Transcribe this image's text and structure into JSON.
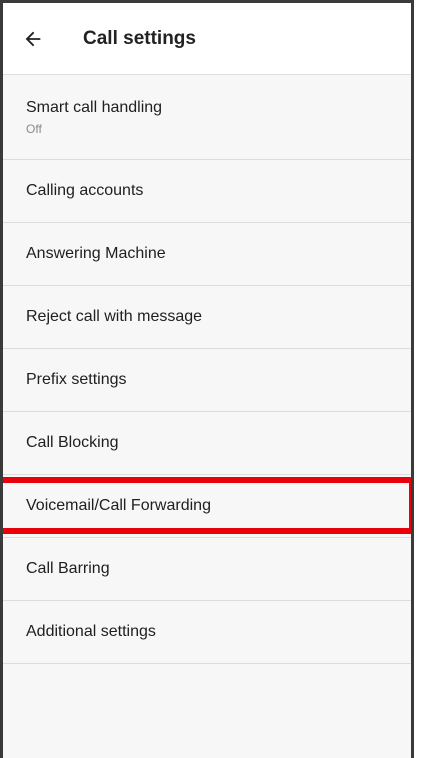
{
  "appbar": {
    "back_icon": "arrow-left-icon",
    "title": "Call settings"
  },
  "settings": {
    "smart_call_handling": {
      "label": "Smart call handling",
      "summary": "Off"
    },
    "calling_accounts": {
      "label": "Calling accounts"
    },
    "answering_machine": {
      "label": "Answering Machine"
    },
    "reject_call_with_message": {
      "label": "Reject call with message"
    },
    "prefix_settings": {
      "label": "Prefix settings"
    },
    "call_blocking": {
      "label": "Call Blocking"
    },
    "voicemail_call_forwarding": {
      "label": "Voicemail/Call Forwarding",
      "highlighted": true
    },
    "call_barring": {
      "label": "Call Barring"
    },
    "additional_settings": {
      "label": "Additional settings"
    }
  },
  "colors": {
    "highlight": "#e8000b",
    "text_primary": "#202020",
    "text_secondary": "#8a8a8a",
    "divider": "#dcdcdc"
  }
}
